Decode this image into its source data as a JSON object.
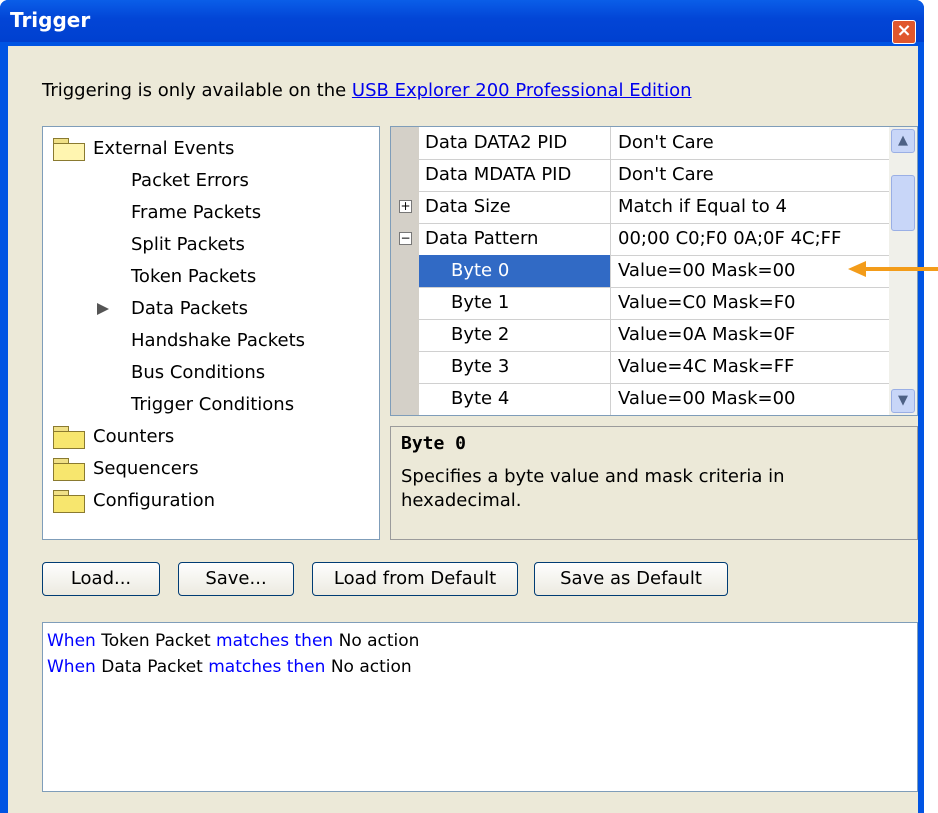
{
  "window": {
    "title": "Trigger",
    "close_label": "×"
  },
  "info": {
    "prefix": "Triggering is only available on the ",
    "link": "USB Explorer 200 Professional Edition"
  },
  "tree": {
    "items": [
      {
        "label": "External Events",
        "kind": "folder-open"
      },
      {
        "label": "Packet Errors",
        "kind": "child"
      },
      {
        "label": "Frame Packets",
        "kind": "child"
      },
      {
        "label": "Split Packets",
        "kind": "child"
      },
      {
        "label": "Token Packets",
        "kind": "child"
      },
      {
        "label": "Data Packets",
        "kind": "child-current"
      },
      {
        "label": "Handshake Packets",
        "kind": "child"
      },
      {
        "label": "Bus Conditions",
        "kind": "child"
      },
      {
        "label": "Trigger Conditions",
        "kind": "child"
      },
      {
        "label": "Counters",
        "kind": "folder"
      },
      {
        "label": "Sequencers",
        "kind": "folder"
      },
      {
        "label": "Configuration",
        "kind": "folder"
      }
    ]
  },
  "grid": {
    "rows": [
      {
        "name": "Data DATA2 PID",
        "value": "Don't Care"
      },
      {
        "name": "Data MDATA PID",
        "value": "Don't Care"
      },
      {
        "name": "Data Size",
        "value": "Match if Equal to 4",
        "expander": "+"
      },
      {
        "name": "Data Pattern",
        "value": "00;00 C0;F0 0A;0F 4C;FF",
        "expander": "−"
      },
      {
        "name": "Byte 0",
        "value": "Value=00  Mask=00",
        "selected": true
      },
      {
        "name": "Byte 1",
        "value": "Value=C0  Mask=F0"
      },
      {
        "name": "Byte 2",
        "value": "Value=0A  Mask=0F"
      },
      {
        "name": "Byte 3",
        "value": "Value=4C  Mask=FF"
      },
      {
        "name": "Byte 4",
        "value": "Value=00  Mask=00"
      }
    ],
    "scroll_up": "▲",
    "scroll_down": "▼"
  },
  "description": {
    "title": "Byte 0",
    "text": "Specifies a byte value and mask criteria in hexadecimal."
  },
  "buttons": {
    "load": "Load...",
    "save": "Save...",
    "load_default": "Load from Default",
    "save_default": "Save as Default"
  },
  "log": {
    "lines": [
      {
        "w1": "When",
        "subject": " Token Packet ",
        "w2": "matches then",
        "action": " No action"
      },
      {
        "w1": "When",
        "subject": " Data Packet ",
        "w2": "matches then",
        "action": " No action"
      }
    ]
  },
  "colors": {
    "title_bar": "#0054e3",
    "selection": "#316ac5",
    "keyword": "#0000ff",
    "annotation_arrow": "#f39c1a"
  }
}
